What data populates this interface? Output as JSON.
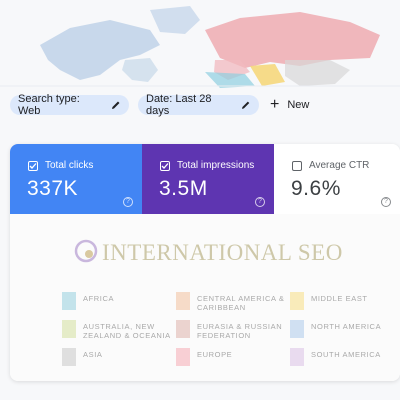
{
  "filters": {
    "search_type_label": "Search type: Web",
    "date_label": "Date: Last 28 days",
    "new_label": "New"
  },
  "metrics": {
    "clicks": {
      "label": "Total clicks",
      "value": "337K",
      "color": "#4285f4",
      "checked": true
    },
    "impressions": {
      "label": "Total impressions",
      "value": "3.5M",
      "color": "#5e35b1",
      "checked": true
    },
    "ctr": {
      "label": "Average CTR",
      "value": "9.6%",
      "checked": false
    }
  },
  "watermark": {
    "title": "INTERNATIONAL SEO",
    "legend": [
      {
        "label": "Africa",
        "color": "#7fc6d6"
      },
      {
        "label": "Central America & Caribbean",
        "color": "#f0b489"
      },
      {
        "label": "Middle East",
        "color": "#f6d76b"
      },
      {
        "label": "Australia, New Zealand & Oceania",
        "color": "#c9d98a"
      },
      {
        "label": "Eurasia & Russian Federation",
        "color": "#d7a29a"
      },
      {
        "label": "North America",
        "color": "#9bbfe6"
      },
      {
        "label": "Asia",
        "color": "#bdbdbd"
      },
      {
        "label": "Europe",
        "color": "#f39aa3"
      },
      {
        "label": "South America",
        "color": "#d3b3e0"
      }
    ]
  },
  "icons": {
    "pencil": "pencil-icon",
    "plus": "plus-icon",
    "checkbox": "checkbox-icon",
    "help": "help-icon"
  }
}
